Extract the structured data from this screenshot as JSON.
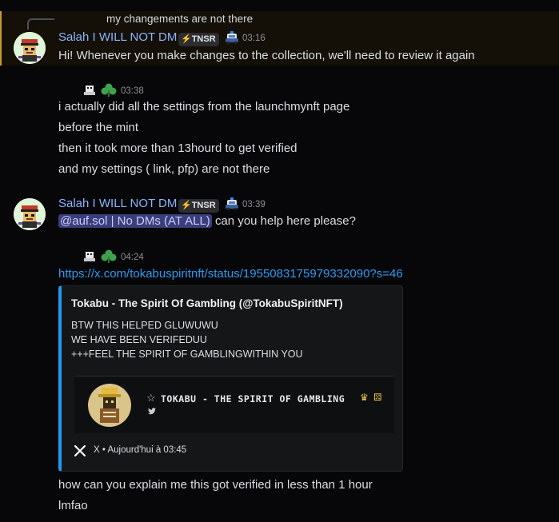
{
  "reply": {
    "text": "my changements are not there"
  },
  "messages": [
    {
      "username": "Salah I WILL NOT DM",
      "badge": "TNSR",
      "time": "03:16",
      "text": "Hi! Whenever you make changes to the collection, we'll need to review it again"
    },
    {
      "time": "03:38",
      "lines": [
        "i actually did all the settings from the launchmynft page",
        "before the mint",
        "then it took more than 13hourd to get verified",
        "and my settings ( link, pfp) are not there"
      ]
    },
    {
      "username": "Salah I WILL NOT DM",
      "badge": "TNSR",
      "time": "03:39",
      "mention": "@auf.sol | No DMs (AT ALL)",
      "text": "can you help here please?"
    },
    {
      "time": "04:24",
      "link": "https://x.com/tokabuspiritnft/status/1955083175979332090?s=46"
    }
  ],
  "embed": {
    "title": "Tokabu - The Spirit Of Gambling (@TokabuSpiritNFT)",
    "description": [
      "BTW THIS HELPED GLUWUWU",
      "WE HAVE BEEN VERIFEDUU",
      "+++FEEL THE SPIRIT OF GAMBLINGWITHIN YOU"
    ],
    "card_title": "TOKABU - THE SPIRIT OF GAMBLING",
    "footer": "X • Aujourd'hui à 03:45"
  },
  "after_embed": [
    "how can you explain me this got verified in less than 1 hour",
    "lmfao"
  ],
  "colors": {
    "background": "#070709",
    "username": "#8ab4f8",
    "link": "#2e9bf0",
    "embed_accent": "#1d9bf0",
    "highlight_border": "#c99a2e"
  }
}
